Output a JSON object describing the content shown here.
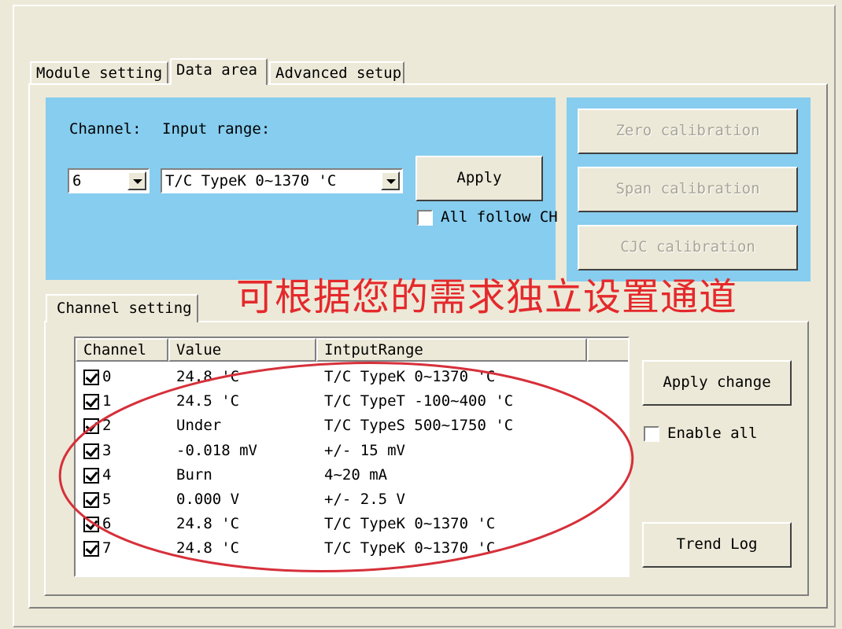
{
  "tabs": [
    "Module setting",
    "Data area",
    "Advanced setup"
  ],
  "top_panel": {
    "channel_label": "Channel:",
    "input_range_label": "Input range:",
    "channel_value": "6",
    "input_range_value": "T/C TypeK 0~1370 'C",
    "apply_label": "Apply",
    "all_follow_label": "All follow CH"
  },
  "calibration": {
    "zero_label": "Zero calibration",
    "span_label": "Span calibration",
    "cjc_label": "CJC calibration"
  },
  "annotation": "可根据您的需求独立设置通道",
  "channel_setting": {
    "group_label": "Channel setting",
    "columns": [
      "Channel",
      "Value",
      "IntputRange"
    ],
    "rows": [
      {
        "channel": "0",
        "value": "24.8 'C",
        "range": "T/C TypeK 0~1370 'C",
        "checked": true
      },
      {
        "channel": "1",
        "value": "24.5 'C",
        "range": "T/C TypeT -100~400 'C",
        "checked": true
      },
      {
        "channel": "2",
        "value": "Under",
        "range": "T/C TypeS 500~1750 'C",
        "checked": true
      },
      {
        "channel": "3",
        "value": "-0.018 mV",
        "range": "+/- 15 mV",
        "checked": true
      },
      {
        "channel": "4",
        "value": "Burn",
        "range": "4~20 mA",
        "checked": true
      },
      {
        "channel": "5",
        "value": "0.000 V",
        "range": "+/- 2.5 V",
        "checked": true
      },
      {
        "channel": "6",
        "value": "24.8 'C",
        "range": "T/C TypeK 0~1370 'C",
        "checked": true
      },
      {
        "channel": "7",
        "value": "24.8 'C",
        "range": "T/C TypeK 0~1370 'C",
        "checked": true
      }
    ],
    "apply_change_label": "Apply change",
    "enable_all_label": "Enable all",
    "trend_log_label": "Trend Log"
  },
  "colors": {
    "background": "#ece9d8",
    "panel_blue": "#86cdef",
    "annotation_red": "#e4292c"
  }
}
